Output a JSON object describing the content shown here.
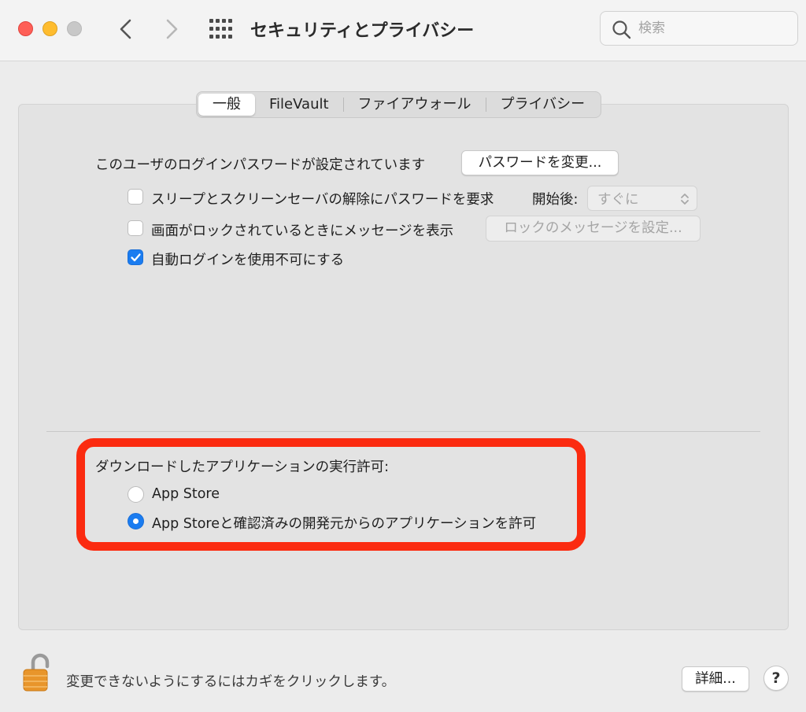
{
  "window": {
    "title": "セキュリティとプライバシー",
    "search_placeholder": "検索"
  },
  "tabs": [
    {
      "label": "一般",
      "active": true
    },
    {
      "label": "FileVault",
      "active": false
    },
    {
      "label": "ファイアウォール",
      "active": false
    },
    {
      "label": "プライバシー",
      "active": false
    }
  ],
  "general": {
    "password_status": "このユーザのログインパスワードが設定されています",
    "change_password_button": "パスワードを変更...",
    "options": [
      {
        "label": "スリープとスクリーンセーバの解除にパスワードを要求",
        "checked": false
      },
      {
        "label": "画面がロックされているときにメッセージを表示",
        "checked": false
      },
      {
        "label": "自動ログインを使用不可にする",
        "checked": true
      }
    ],
    "start_after_label": "開始後:",
    "start_after_value": "すぐに",
    "lock_message_button": "ロックのメッセージを設定..."
  },
  "downloads": {
    "heading": "ダウンロードしたアプリケーションの実行許可:",
    "options": [
      {
        "label": "App Store",
        "selected": false
      },
      {
        "label": "App Storeと確認済みの開発元からのアプリケーションを許可",
        "selected": true
      }
    ]
  },
  "footer": {
    "lock_text": "変更できないようにするにはカギをクリックします。",
    "advanced_button": "詳細...",
    "help_button": "?"
  },
  "colors": {
    "highlight_border": "#fb2b10",
    "accent": "#1a7cf0"
  }
}
